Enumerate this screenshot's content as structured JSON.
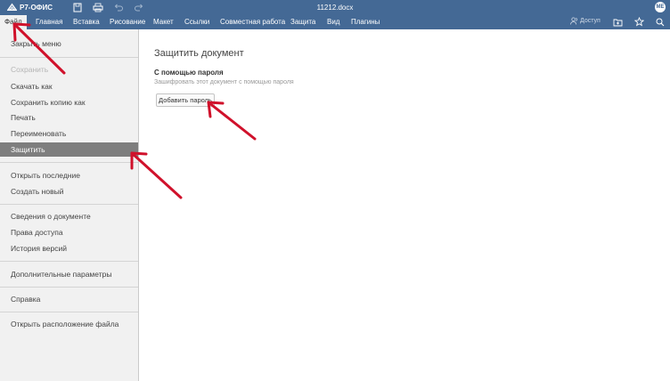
{
  "app": {
    "logo_text": "Р7-ОФИС",
    "document_title": "11212.docx",
    "user_initials": "МЕ"
  },
  "tabs": [
    {
      "label": "Файл"
    },
    {
      "label": "Главная"
    },
    {
      "label": "Вставка"
    },
    {
      "label": "Рисование"
    },
    {
      "label": "Макет"
    },
    {
      "label": "Ссылки"
    },
    {
      "label": "Совместная работа"
    },
    {
      "label": "Защита"
    },
    {
      "label": "Вид"
    },
    {
      "label": "Плагины"
    }
  ],
  "toolbar_right": {
    "access_label": "Доступ"
  },
  "sidebar": {
    "items": [
      {
        "label": "Закрыть меню"
      },
      {
        "label": "Сохранить"
      },
      {
        "label": "Скачать как"
      },
      {
        "label": "Сохранить копию как"
      },
      {
        "label": "Печать"
      },
      {
        "label": "Переименовать"
      },
      {
        "label": "Защитить"
      },
      {
        "label": "Открыть последние"
      },
      {
        "label": "Создать новый"
      },
      {
        "label": "Сведения о документе"
      },
      {
        "label": "Права доступа"
      },
      {
        "label": "История версий"
      },
      {
        "label": "Дополнительные параметры"
      },
      {
        "label": "Справка"
      },
      {
        "label": "Открыть расположение файла"
      }
    ]
  },
  "panel": {
    "title": "Защитить документ",
    "section_title": "С помощью пароля",
    "section_desc": "Зашифровать этот документ с помощью пароля",
    "add_password_button": "Добавить пароль"
  },
  "colors": {
    "header_bg": "#446995",
    "sidebar_bg": "#f1f1f1",
    "selected_bg": "#7e7e7e",
    "annotation_arrow": "#d0112b"
  }
}
